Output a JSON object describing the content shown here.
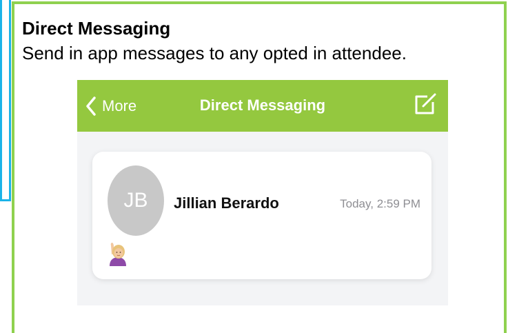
{
  "slide": {
    "title": "Direct Messaging",
    "subtitle": "Send in app messages to any opted in attendee."
  },
  "navbar": {
    "back_label": "More",
    "title": "Direct Messaging",
    "back_icon": "chevron-left-icon",
    "compose_icon": "compose-icon",
    "color": "#94c83f"
  },
  "messages": [
    {
      "initials": "JB",
      "sender": "Jillian Berardo",
      "time": "Today, 2:59 PM",
      "preview_icon": "raising-hand-emoji-icon"
    }
  ],
  "colors": {
    "frame_green": "#8fd14f",
    "frame_blue": "#1bb3e8",
    "avatar_gray": "#c8c8c8"
  }
}
